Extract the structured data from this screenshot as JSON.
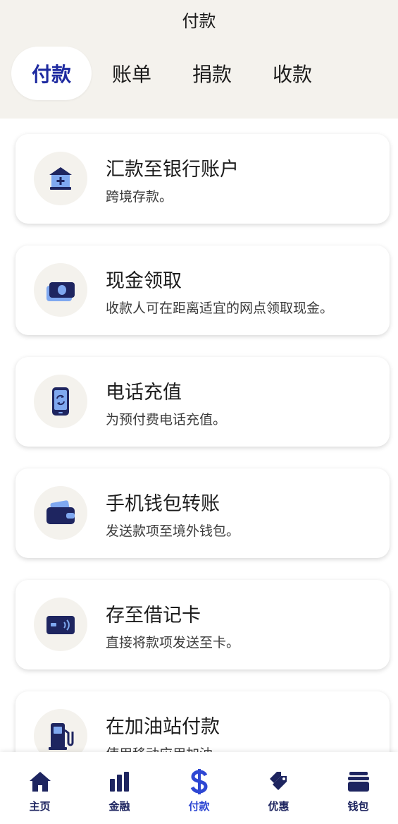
{
  "header": {
    "title": "付款"
  },
  "tabs": [
    {
      "label": "付款",
      "active": true
    },
    {
      "label": "账单",
      "active": false
    },
    {
      "label": "捐款",
      "active": false
    },
    {
      "label": "收款",
      "active": false
    }
  ],
  "services": [
    {
      "icon": "bank-icon",
      "title": "汇款至银行账户",
      "subtitle": "跨境存款。"
    },
    {
      "icon": "cash-icon",
      "title": "现金领取",
      "subtitle": "收款人可在距离适宜的网点领取现金。"
    },
    {
      "icon": "phone-topup-icon",
      "title": "电话充值",
      "subtitle": "为预付费电话充值。"
    },
    {
      "icon": "wallet-icon",
      "title": "手机钱包转账",
      "subtitle": "发送款项至境外钱包。"
    },
    {
      "icon": "debit-card-icon",
      "title": "存至借记卡",
      "subtitle": "直接将款项发送至卡。"
    },
    {
      "icon": "fuel-pump-icon",
      "title": "在加油站付款",
      "subtitle": "使用移动应用加油。"
    }
  ],
  "bottom_nav": [
    {
      "icon": "home-icon",
      "label": "主页",
      "active": false
    },
    {
      "icon": "finance-chart-icon",
      "label": "金融",
      "active": false
    },
    {
      "icon": "dollar-icon",
      "label": "付款",
      "active": true
    },
    {
      "icon": "tags-icon",
      "label": "优惠",
      "active": false
    },
    {
      "icon": "wallet-stack-icon",
      "label": "钱包",
      "active": false
    }
  ],
  "colors": {
    "accent": "#2e47d3",
    "navy": "#1e2560",
    "light_blue": "#7fa8f0",
    "header_bg": "#f4f2ed"
  }
}
